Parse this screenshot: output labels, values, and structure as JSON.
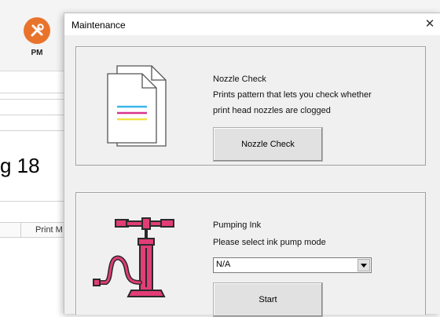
{
  "background": {
    "pm_label": "PM",
    "figure_label": "g 18",
    "column_header": "Print M"
  },
  "dialog": {
    "title": "Maintenance",
    "close_glyph": "✕",
    "nozzle": {
      "heading": "Nozzle Check",
      "description_line1": "Prints pattern that lets you check whether",
      "description_line2": "print head nozzles are clogged",
      "button_label": "Nozzle Check",
      "icon": "document-pages-icon"
    },
    "pumping": {
      "heading": "Pumping Ink",
      "prompt": "Please select ink pump mode",
      "select_value": "N/A",
      "button_label": "Start",
      "icon": "ink-pump-icon"
    }
  },
  "colors": {
    "pm_orange": "#e8742c",
    "pump_pink": "#e23d77",
    "pump_dark": "#2a2a2a",
    "stripe_cyan": "#3ab6e8",
    "stripe_magenta": "#d8348a",
    "stripe_yellow": "#f2e045"
  }
}
